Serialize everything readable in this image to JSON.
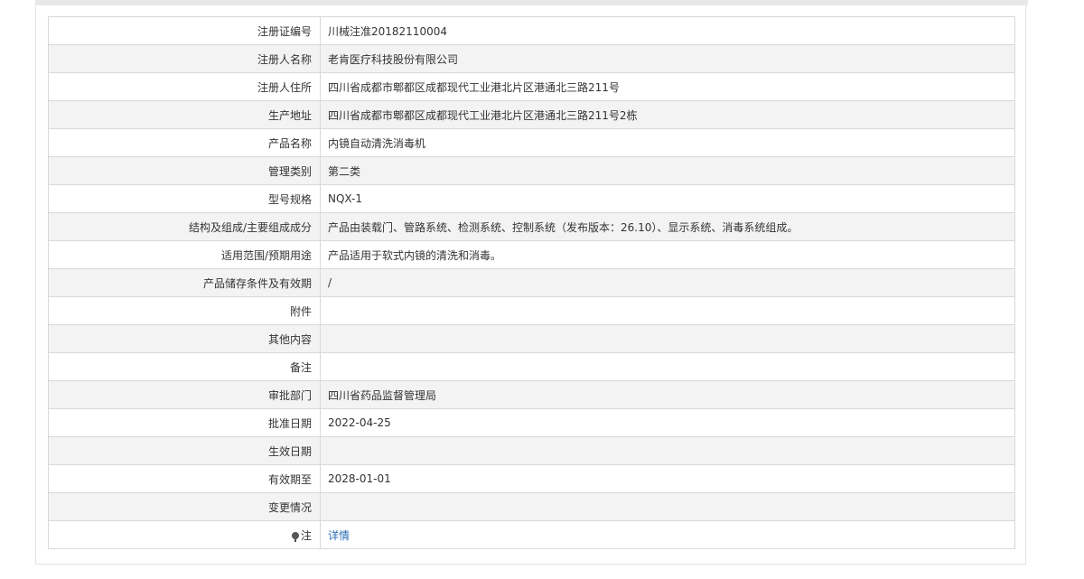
{
  "rows": [
    {
      "label": "注册证编号",
      "value": "川械注准20182110004"
    },
    {
      "label": "注册人名称",
      "value": "老肯医疗科技股份有限公司"
    },
    {
      "label": "注册人住所",
      "value": "四川省成都市郫都区成都现代工业港北片区港通北三路211号"
    },
    {
      "label": "生产地址",
      "value": "四川省成都市郫都区成都现代工业港北片区港通北三路211号2栋"
    },
    {
      "label": "产品名称",
      "value": "内镜自动清洗消毒机"
    },
    {
      "label": "管理类别",
      "value": "第二类"
    },
    {
      "label": "型号规格",
      "value": "NQX-1"
    },
    {
      "label": "结构及组成/主要组成成分",
      "value": "产品由装载门、管路系统、检测系统、控制系统（发布版本：26.10）、显示系统、消毒系统组成。"
    },
    {
      "label": "适用范围/预期用途",
      "value": "产品适用于软式内镜的清洗和消毒。"
    },
    {
      "label": "产品储存条件及有效期",
      "value": "/"
    },
    {
      "label": "附件",
      "value": ""
    },
    {
      "label": "其他内容",
      "value": ""
    },
    {
      "label": "备注",
      "value": ""
    },
    {
      "label": "审批部门",
      "value": "四川省药品监督管理局"
    },
    {
      "label": "批准日期",
      "value": "2022-04-25"
    },
    {
      "label": "生效日期",
      "value": ""
    },
    {
      "label": "有效期至",
      "value": "2028-01-01"
    },
    {
      "label": "变更情况",
      "value": ""
    }
  ],
  "note": {
    "icon": "pin-icon",
    "label": "注",
    "link_text": "详情",
    "link_color": "#2a6db6"
  }
}
